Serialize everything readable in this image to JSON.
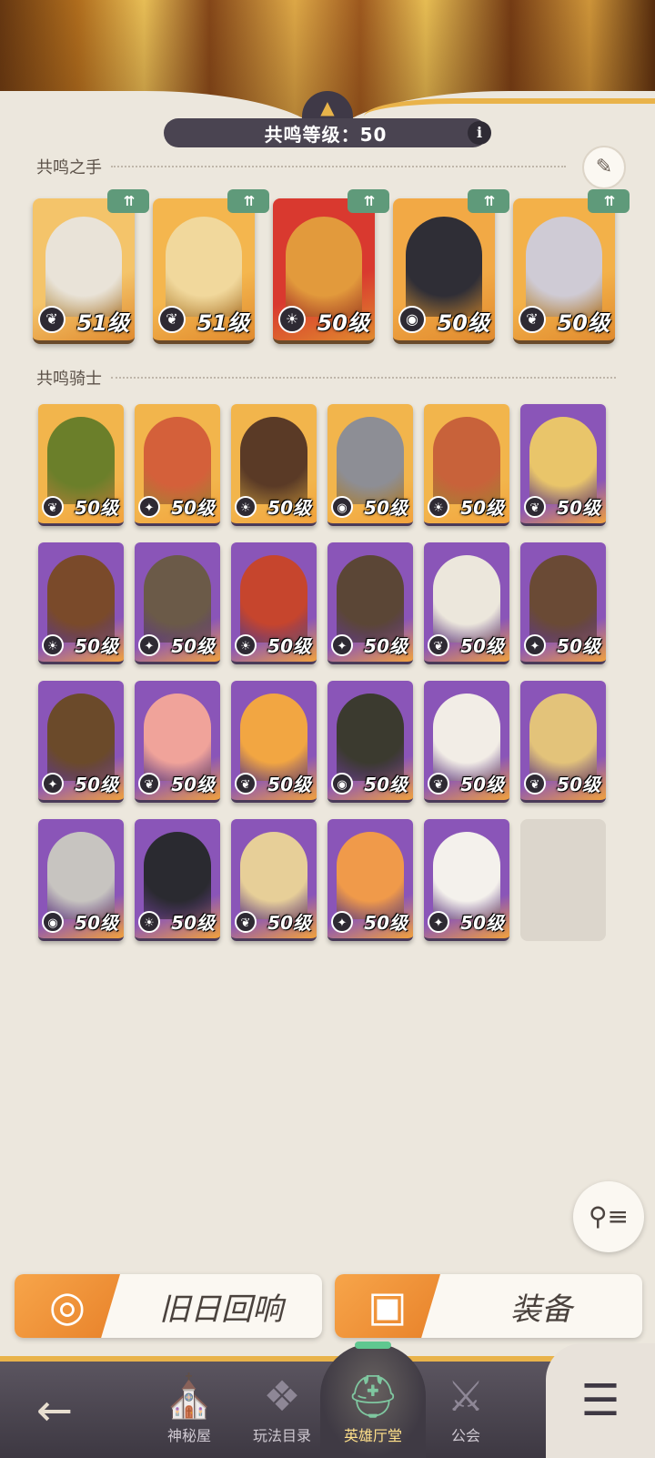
{
  "header": {
    "level_text": "共鸣等级：50",
    "info_icon": "i",
    "emblem_icon": "crest-icon"
  },
  "sections": {
    "hand_title": "共鸣之手",
    "knight_title": "共鸣骑士"
  },
  "hand_cards": [
    {
      "level": "51级",
      "class_icon": "leaf",
      "badge": "⇈",
      "colors": [
        "#f4c46a",
        "#e9e3d8"
      ]
    },
    {
      "level": "51级",
      "class_icon": "leaf",
      "badge": "⇈",
      "colors": [
        "#f4b64e",
        "#f1d89c"
      ]
    },
    {
      "level": "50级",
      "class_icon": "sun",
      "badge": "⇈",
      "colors": [
        "#d9392f",
        "#e29a3c"
      ]
    },
    {
      "level": "50级",
      "class_icon": "eye",
      "badge": "⇈",
      "colors": [
        "#f2a945",
        "#2f2e36"
      ]
    },
    {
      "level": "50级",
      "class_icon": "leaf",
      "badge": "⇈",
      "colors": [
        "#f3b149",
        "#cfcbd5"
      ]
    }
  ],
  "knights": [
    {
      "level": "50级",
      "class_icon": "leaf",
      "colors": [
        "#f2b54c",
        "#6b7f2a"
      ]
    },
    {
      "level": "50级",
      "class_icon": "star",
      "colors": [
        "#f2b54c",
        "#d4603a"
      ]
    },
    {
      "level": "50级",
      "class_icon": "sun",
      "colors": [
        "#f2b54c",
        "#5a3a26"
      ]
    },
    {
      "level": "50级",
      "class_icon": "eye",
      "colors": [
        "#f2b54c",
        "#8d8e95"
      ]
    },
    {
      "level": "50级",
      "class_icon": "sun",
      "colors": [
        "#f2b54c",
        "#c8623a"
      ]
    },
    {
      "level": "50级",
      "class_icon": "leaf",
      "colors": [
        "#8a55b8",
        "#e9c56a"
      ]
    },
    {
      "level": "50级",
      "class_icon": "sun",
      "colors": [
        "#8a55b8",
        "#7a4a2a"
      ]
    },
    {
      "level": "50级",
      "class_icon": "star",
      "colors": [
        "#8a55b8",
        "#6b5a48"
      ]
    },
    {
      "level": "50级",
      "class_icon": "sun",
      "colors": [
        "#8a55b8",
        "#c6452d"
      ]
    },
    {
      "level": "50级",
      "class_icon": "star",
      "colors": [
        "#8a55b8",
        "#5b4636"
      ]
    },
    {
      "level": "50级",
      "class_icon": "leaf",
      "colors": [
        "#8a55b8",
        "#ece7dc"
      ]
    },
    {
      "level": "50级",
      "class_icon": "star",
      "colors": [
        "#8a55b8",
        "#6a4a35"
      ]
    },
    {
      "level": "50级",
      "class_icon": "star",
      "colors": [
        "#8a55b8",
        "#6b4a2a"
      ]
    },
    {
      "level": "50级",
      "class_icon": "leaf",
      "colors": [
        "#8a55b8",
        "#f0a39a"
      ]
    },
    {
      "level": "50级",
      "class_icon": "leaf",
      "colors": [
        "#8a55b8",
        "#f2a642"
      ]
    },
    {
      "level": "50级",
      "class_icon": "eye",
      "colors": [
        "#8a55b8",
        "#3b3a2f"
      ]
    },
    {
      "level": "50级",
      "class_icon": "leaf",
      "colors": [
        "#8a55b8",
        "#f2ede6"
      ]
    },
    {
      "level": "50级",
      "class_icon": "leaf",
      "colors": [
        "#8a55b8",
        "#e3c37a"
      ]
    },
    {
      "level": "50级",
      "class_icon": "eye",
      "colors": [
        "#8a55b8",
        "#c7c4c0"
      ]
    },
    {
      "level": "50级",
      "class_icon": "sun",
      "colors": [
        "#8a55b8",
        "#2a2a30"
      ]
    },
    {
      "level": "50级",
      "class_icon": "leaf",
      "colors": [
        "#8a55b8",
        "#e7cf98"
      ]
    },
    {
      "level": "50级",
      "class_icon": "star",
      "colors": [
        "#8a55b8",
        "#f09a4a"
      ]
    },
    {
      "level": "50级",
      "class_icon": "star",
      "colors": [
        "#8a55b8",
        "#f4f1ec"
      ]
    }
  ],
  "actions": {
    "echoes_label": "旧日回响",
    "equipment_label": "装备"
  },
  "nav": {
    "items": [
      {
        "label": "神秘屋",
        "icon": "hat-icon",
        "glyph": "⛪"
      },
      {
        "label": "玩法目录",
        "icon": "diamond-grid-icon",
        "glyph": "❖"
      },
      {
        "label": "英雄厅堂",
        "icon": "helmet-icon",
        "glyph": "⛑"
      },
      {
        "label": "公会",
        "icon": "crossed-swords-icon",
        "glyph": "⚔"
      }
    ],
    "back_glyph": "←",
    "menu_glyph": "☰"
  },
  "icons": {
    "leaf": "❦",
    "star": "✦",
    "sun": "☀",
    "eye": "◉",
    "filter": "⚲≡",
    "edit": "✎"
  }
}
